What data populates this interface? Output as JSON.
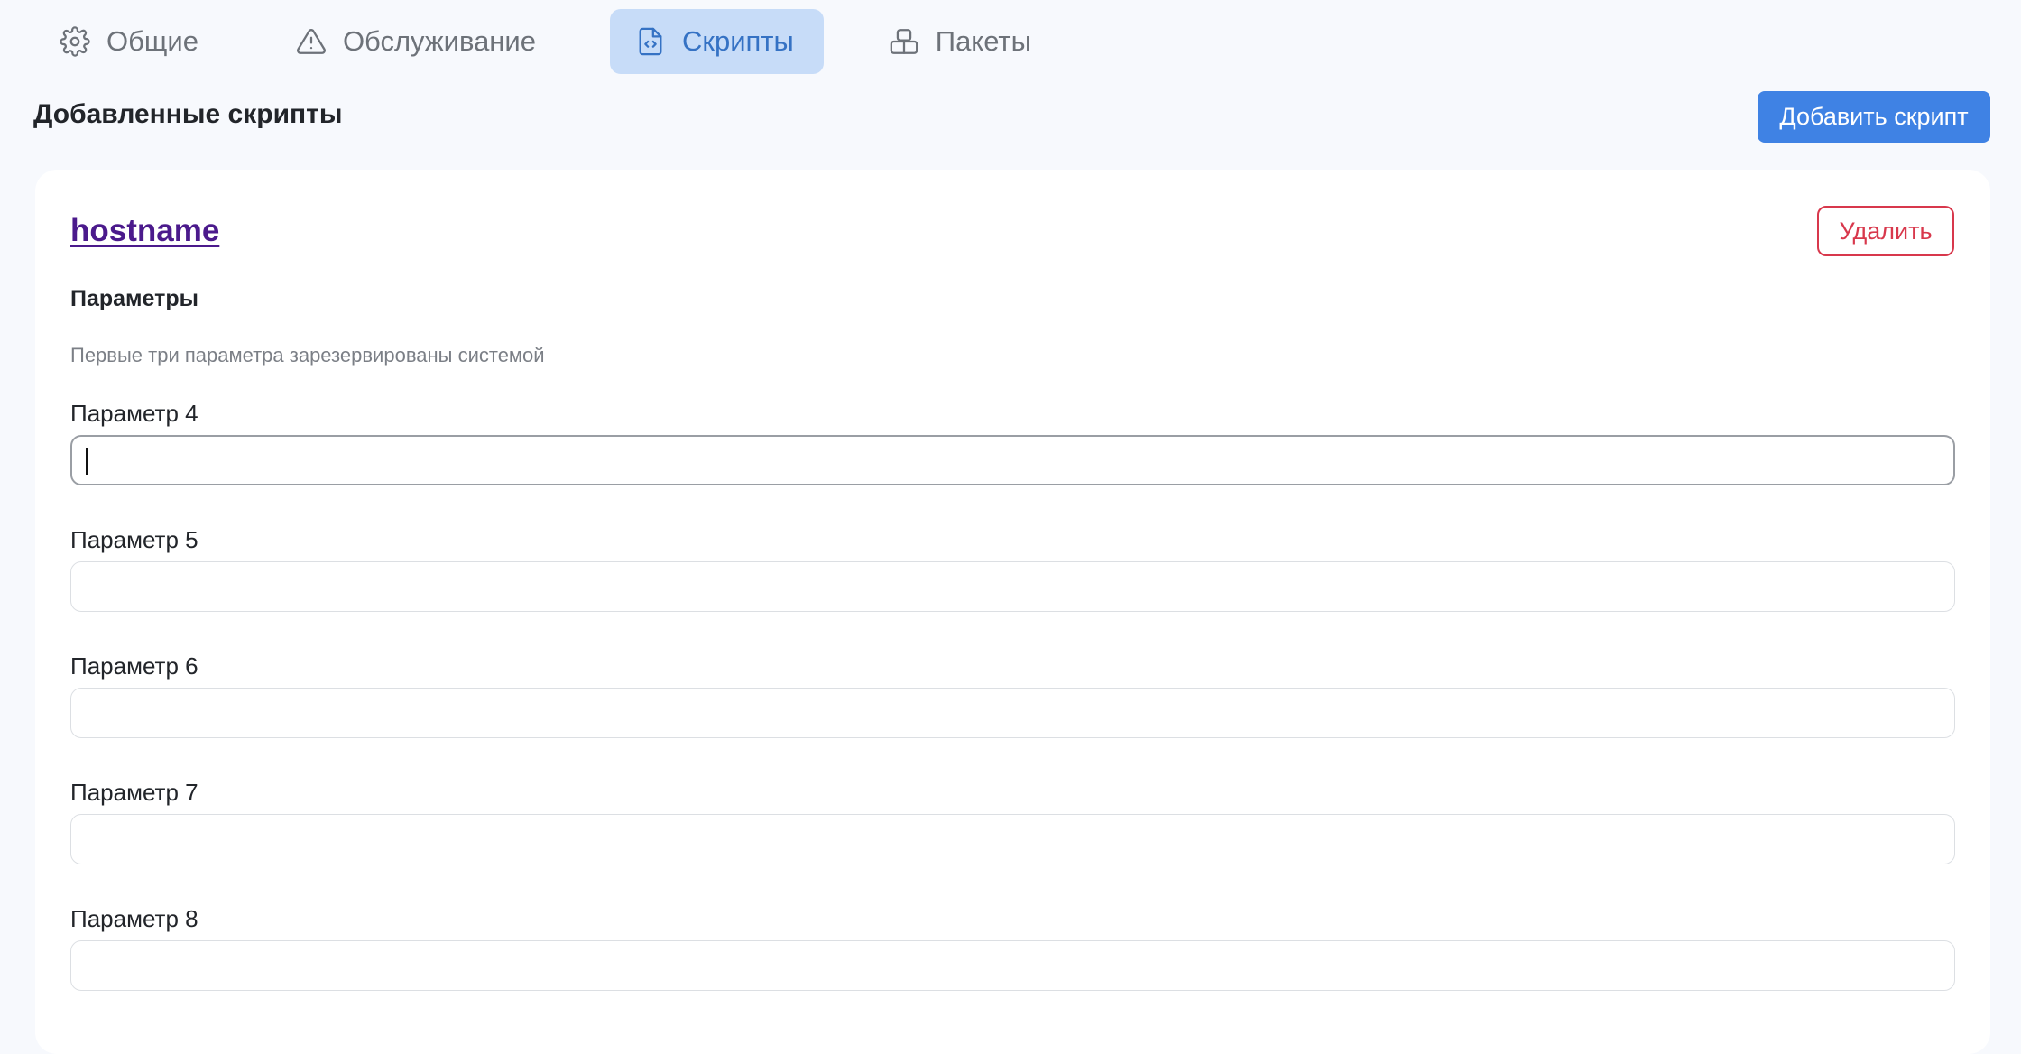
{
  "tabs": [
    {
      "label": "Общие",
      "icon": "gear-icon",
      "active": false
    },
    {
      "label": "Обслуживание",
      "icon": "warning-triangle-icon",
      "active": false
    },
    {
      "label": "Скрипты",
      "icon": "code-file-icon",
      "active": true
    },
    {
      "label": "Пакеты",
      "icon": "package-icon",
      "active": false
    }
  ],
  "section": {
    "title": "Добавленные скрипты",
    "add_button": "Добавить скрипт"
  },
  "script": {
    "name": "hostname",
    "delete_button": "Удалить",
    "params_heading": "Параметры",
    "params_note": "Первые три параметра зарезервированы системой",
    "params": [
      {
        "label": "Параметр 4",
        "value": ""
      },
      {
        "label": "Параметр 5",
        "value": ""
      },
      {
        "label": "Параметр 6",
        "value": ""
      },
      {
        "label": "Параметр 7",
        "value": ""
      },
      {
        "label": "Параметр 8",
        "value": ""
      }
    ]
  },
  "colors": {
    "accent": "#3f82e4",
    "active_tab_bg": "#c7dcf8",
    "active_tab_text": "#3572c4",
    "danger": "#d8384c",
    "link_visited": "#4b1a8c",
    "page_bg": "#f7f9fd"
  }
}
